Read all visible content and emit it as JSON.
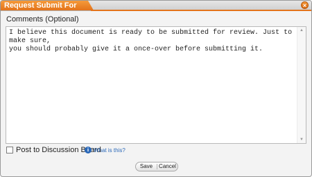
{
  "dialog": {
    "title": "Request Submit For Review",
    "close_icon": "close-icon"
  },
  "comments": {
    "label": "Comments (Optional)",
    "value": "I believe this document is ready to be submitted for review. Just to make sure,\nyou should probably give it a once-over before submitting it."
  },
  "post_to_board": {
    "label": "Post to Discussion Board",
    "checked": false,
    "info_icon": "info-icon",
    "help_link": "What is this?"
  },
  "buttons": {
    "save": "Save",
    "cancel": "Cancel"
  },
  "colors": {
    "title_accent": "#e3731a",
    "link": "#2a68b8"
  }
}
